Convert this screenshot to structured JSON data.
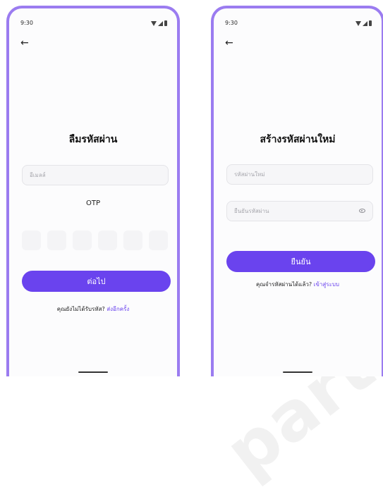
{
  "accent_color": "#6a43ee",
  "frame_color": "#9b7cf0",
  "watermark": "part",
  "screens": [
    {
      "status_time": "9:30",
      "title": "ลืมรหัสผ่าน",
      "email_placeholder": "อีเมลล์",
      "otp_label": "OTP",
      "otp_digits": 6,
      "button_label": "ต่อไป",
      "footer_text": "คุณยังไม่ได้รับรหัส?",
      "footer_link": "ส่งอีกครั้ง"
    },
    {
      "status_time": "9:30",
      "title": "สร้างรหัสผ่านใหม่",
      "new_password_placeholder": "รหัสผ่านใหม่",
      "confirm_password_placeholder": "ยืนยันรหัสผ่าน",
      "button_label": "ยืนยัน",
      "footer_text": "คุณจำรหัสผ่านได้แล้ว?",
      "footer_link": "เข้าสู่ระบบ"
    }
  ],
  "icons": [
    "back-arrow-icon",
    "wifi-icon",
    "signal-icon",
    "battery-icon",
    "eye-icon"
  ]
}
